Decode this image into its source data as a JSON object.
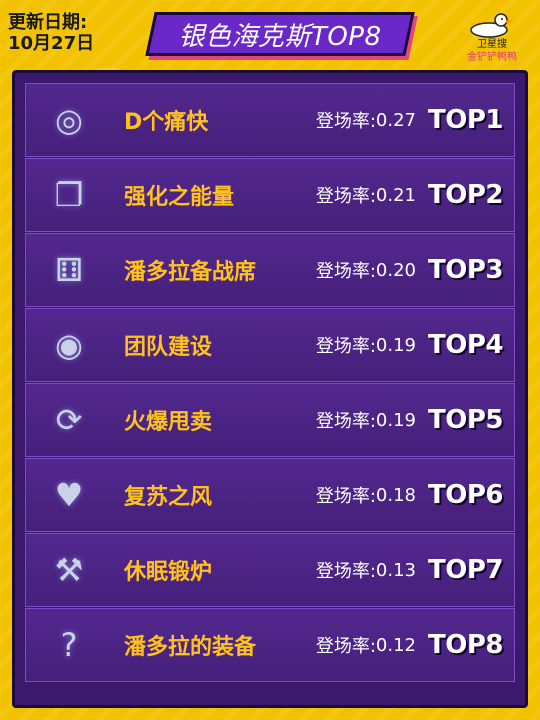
{
  "update": {
    "line1": "更新日期:",
    "line2": "10月27日"
  },
  "title": "银色海克斯TOP8",
  "logo": {
    "line1": "卫星搜",
    "line2": "金铲铲鸭鸭",
    "icon": "duck-icon"
  },
  "rate_label": "登场率: ",
  "items": [
    {
      "name": "D个痛快",
      "rate": "0.27",
      "rank": "TOP1",
      "icon": "refresh-spiral-icon",
      "glyph": "◎"
    },
    {
      "name": "强化之能量",
      "rate": "0.21",
      "rank": "TOP2",
      "icon": "cards-upgrade-icon",
      "glyph": "❐"
    },
    {
      "name": "潘多拉备战席",
      "rate": "0.20",
      "rank": "TOP3",
      "icon": "dice-box-icon",
      "glyph": "⚅"
    },
    {
      "name": "团队建设",
      "rate": "0.19",
      "rank": "TOP4",
      "icon": "team-shield-icon",
      "glyph": "◉"
    },
    {
      "name": "火爆甩卖",
      "rate": "0.19",
      "rank": "TOP5",
      "icon": "dice-refresh-icon",
      "glyph": "⟳"
    },
    {
      "name": "复苏之风",
      "rate": "0.18",
      "rank": "TOP6",
      "icon": "heart-icon",
      "glyph": "♥"
    },
    {
      "name": "休眠锻炉",
      "rate": "0.13",
      "rank": "TOP7",
      "icon": "anvil-clock-icon",
      "glyph": "⚒"
    },
    {
      "name": "潘多拉的装备",
      "rate": "0.12",
      "rank": "TOP8",
      "icon": "mystery-box-icon",
      "glyph": "?"
    }
  ],
  "colors": {
    "background": "#f2c200",
    "panel": "#3b1a6e",
    "row": "#53288f",
    "name": "#ffc21a",
    "title_banner": "#6b28c8"
  }
}
